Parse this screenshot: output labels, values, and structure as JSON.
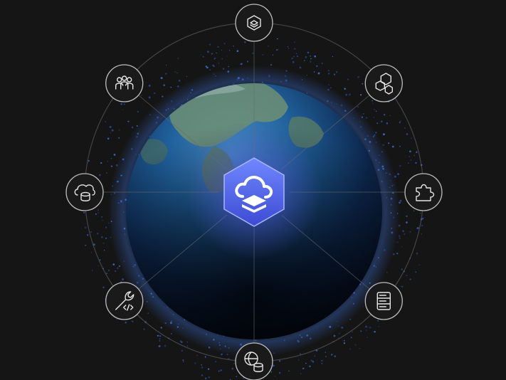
{
  "colors": {
    "background": "#151515",
    "ring": "#6b6b6b",
    "node_fill": "#1a1a1a",
    "node_stroke": "#bdbdbd",
    "icon_stroke": "#e6e6e6",
    "hub_top": "#6e86ff",
    "hub_bottom": "#3f4fd6",
    "glow": "#5f6bff",
    "ocean_light": "#3f86c2",
    "ocean_dark": "#071226",
    "land": "#6f8f73"
  },
  "hub": {
    "icon": "cloud-layers-icon"
  },
  "nodes": [
    {
      "id": "top",
      "icon": "box-layers-icon",
      "angle": -90
    },
    {
      "id": "upper-right",
      "icon": "hexagons-icon",
      "angle": -40
    },
    {
      "id": "right",
      "icon": "puzzle-icon",
      "angle": 0
    },
    {
      "id": "lower-right",
      "icon": "server-list-icon",
      "angle": 40
    },
    {
      "id": "bottom",
      "icon": "globe-database-icon",
      "angle": 90
    },
    {
      "id": "lower-left",
      "icon": "wrench-code-icon",
      "angle": 140
    },
    {
      "id": "left",
      "icon": "cloud-database-icon",
      "angle": 180
    },
    {
      "id": "upper-left",
      "icon": "group-users-icon",
      "angle": 220
    }
  ]
}
